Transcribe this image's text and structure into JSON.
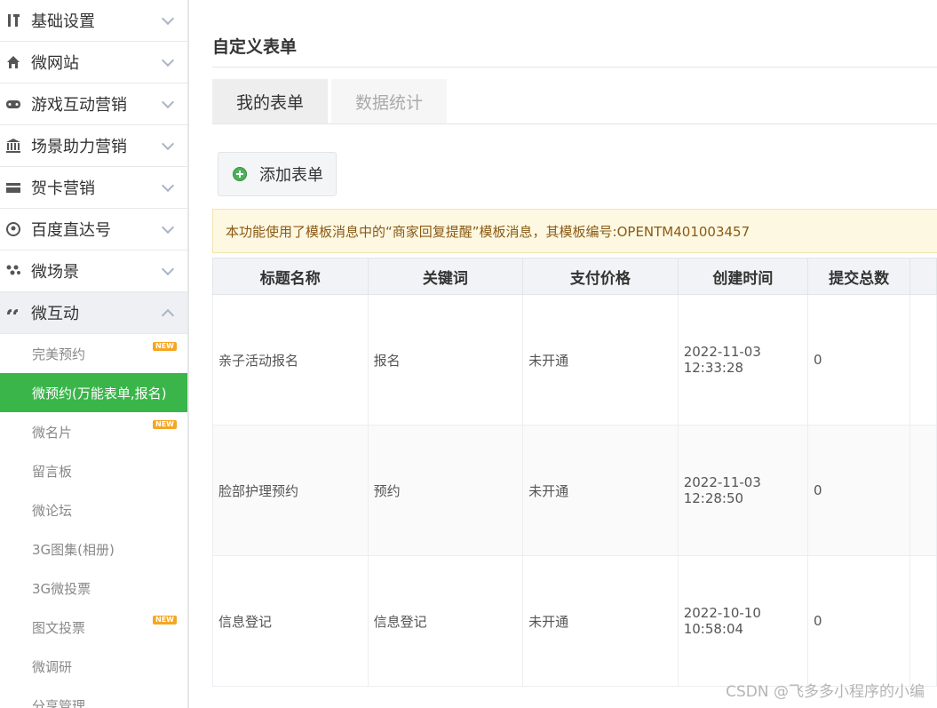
{
  "sidebar": {
    "items": [
      {
        "label": "基础设置",
        "icon": "tools-icon"
      },
      {
        "label": "微网站",
        "icon": "home-icon"
      },
      {
        "label": "游戏互动营销",
        "icon": "gamepad-icon"
      },
      {
        "label": "场景助力营销",
        "icon": "bank-icon"
      },
      {
        "label": "贺卡营销",
        "icon": "card-icon"
      },
      {
        "label": "百度直达号",
        "icon": "baidu-icon"
      },
      {
        "label": "微场景",
        "icon": "scene-icon"
      },
      {
        "label": "微互动",
        "icon": "interact-icon"
      }
    ],
    "sub_items": [
      {
        "label": "完美预约",
        "badge": "NEW"
      },
      {
        "label": "微预约(万能表单,报名)",
        "badge": ""
      },
      {
        "label": "微名片",
        "badge": "NEW"
      },
      {
        "label": "留言板",
        "badge": ""
      },
      {
        "label": "微论坛",
        "badge": ""
      },
      {
        "label": "3G图集(相册)",
        "badge": ""
      },
      {
        "label": "3G微投票",
        "badge": ""
      },
      {
        "label": "图文投票",
        "badge": "NEW"
      },
      {
        "label": "微调研",
        "badge": ""
      },
      {
        "label": "分享管理",
        "badge": ""
      }
    ]
  },
  "main": {
    "title": "自定义表单",
    "tabs": [
      {
        "label": "我的表单"
      },
      {
        "label": "数据统计"
      }
    ],
    "add_button": "添加表单",
    "notice": "本功能使用了模板消息中的“商家回复提醒”模板消息，其模板编号:OPENTM401003457"
  },
  "table": {
    "headers": [
      "标题名称",
      "关键词",
      "支付价格",
      "创建时间",
      "提交总数"
    ],
    "rows": [
      {
        "title": "亲子活动报名",
        "keyword": "报名",
        "price": "未开通",
        "created": "2022-11-03 12:33:28",
        "total": "0"
      },
      {
        "title": "脸部护理预约",
        "keyword": "预约",
        "price": "未开通",
        "created": "2022-11-03 12:28:50",
        "total": "0"
      },
      {
        "title": "信息登记",
        "keyword": "信息登记",
        "price": "未开通",
        "created": "2022-10-10 10:58:04",
        "total": "0"
      }
    ]
  },
  "watermark": "CSDN @飞多多小程序的小编",
  "colors": {
    "accent_green": "#3ab54a",
    "badge_orange": "#f5a623",
    "notice_bg": "#fdf8e1",
    "notice_text": "#8a5a16"
  }
}
